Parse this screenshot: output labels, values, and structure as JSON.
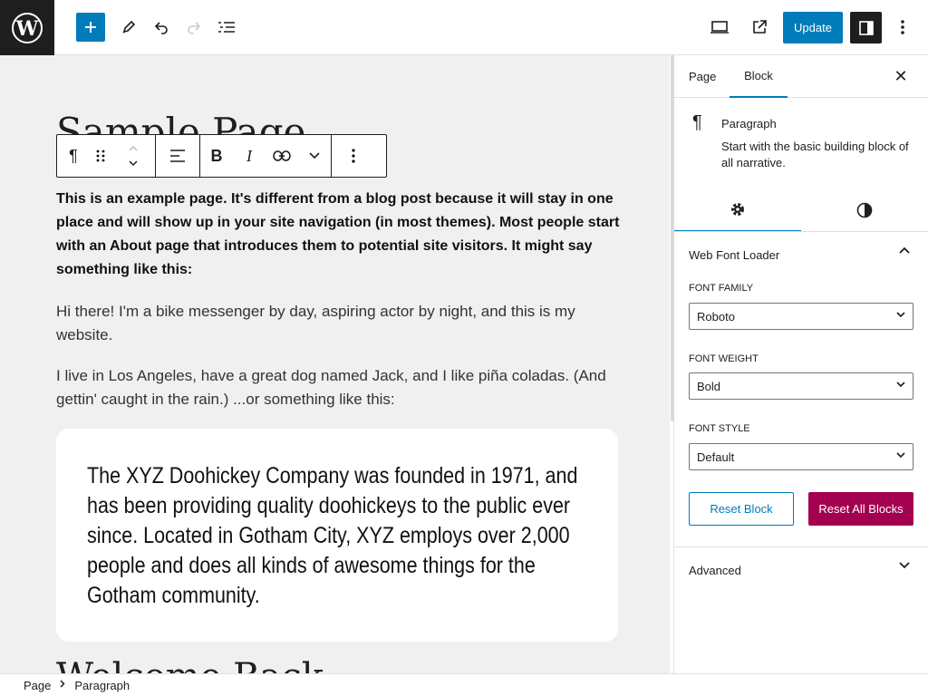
{
  "topbar": {
    "update_label": "Update"
  },
  "editor": {
    "page_title": "Sample Page",
    "intro_paragraph": "This is an example page. It's different from a blog post because it will stay in one place and will show up in your site navigation (in most themes). Most people start with an About page that introduces them to potential site visitors. It might say something like this:",
    "paragraph_2": "Hi there! I'm a bike messenger by day, aspiring actor by night, and this is my website.",
    "paragraph_3": "I live in Los Angeles, have a great dog named Jack, and I like piña coladas. (And gettin' caught in the rain.) ...or something like this:",
    "quote": "The XYZ Doohickey Company was founded in 1971, and has been providing quality doohickeys to the public ever since. Located in Gotham City, XYZ employs over 2,000 people and does all kinds of awesome things for the Gotham community.",
    "next_heading": "Welcome Back"
  },
  "sidebar": {
    "tabs": [
      {
        "label": "Page"
      },
      {
        "label": "Block"
      }
    ],
    "block": {
      "name": "Paragraph",
      "description": "Start with the basic building block of all narrative."
    },
    "panel": {
      "title": "Web Font Loader",
      "font_family_label": "FONT FAMILY",
      "font_family_value": "Roboto",
      "font_weight_label": "FONT WEIGHT",
      "font_weight_value": "Bold",
      "font_style_label": "FONT STYLE",
      "font_style_value": "Default",
      "reset_block_label": "Reset Block",
      "reset_all_label": "Reset All Blocks"
    },
    "advanced_label": "Advanced"
  },
  "breadcrumb": {
    "items": [
      "Page",
      "Paragraph"
    ]
  },
  "colors": {
    "accent": "#007cba",
    "danger": "#a30050",
    "dark": "#1e1e1e"
  }
}
